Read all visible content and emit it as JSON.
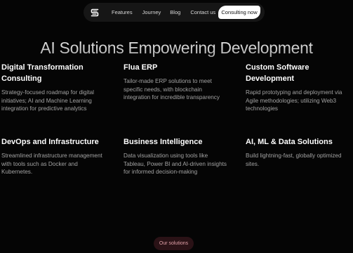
{
  "nav": {
    "logo_icon": "logo-s-icon",
    "links": [
      "Features",
      "Journey",
      "Blog",
      "Contact us"
    ],
    "cta_label": "Consulting now"
  },
  "hero": {
    "title": "AI Solutions Empowering Development"
  },
  "services": [
    {
      "title": "Digital Transformation Consulting",
      "description": "Strategy-focused roadmap for digital initiatives; AI and Machine Learning integration for predictive analytics"
    },
    {
      "title": "Flua ERP",
      "description": "Tailor-made ERP solutions to meet specific needs, with blockchain integration for incredible transparency"
    },
    {
      "title": "Custom Software Development",
      "description": "Rapid prototyping and deployment via Agile methodologies; utilizing Web3 technologies"
    },
    {
      "title": "DevOps and Infrastructure",
      "description": "Streamlined infrastructure management with tools such as Docker and Kubernetes."
    },
    {
      "title": "Business Intelligence",
      "description": "Data visualization using tools like Tableau, Power BI and AI-driven insights for informed decision-making"
    },
    {
      "title": "AI, ML & Data Solutions",
      "description": "Build lightning-fast, globally optimized sites."
    }
  ],
  "footer": {
    "solutions_label": "Our solutions"
  },
  "colors": {
    "background": "#050505",
    "nav_background": "#161616",
    "cta_background": "#ffffff",
    "solutions_background": "#2a1216",
    "solutions_text": "#e0a0a8"
  }
}
